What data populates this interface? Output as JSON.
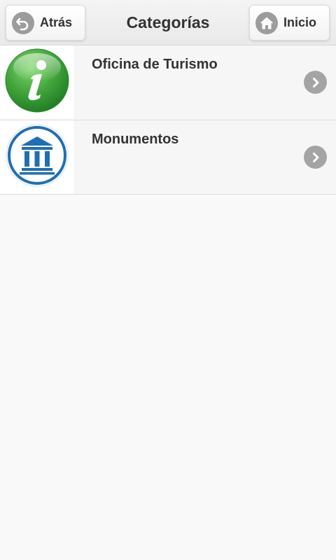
{
  "header": {
    "title": "Categorías",
    "back_label": "Atrás",
    "home_label": "Inicio"
  },
  "categories": [
    {
      "label": "Oficina de Turismo",
      "icon": "info-icon"
    },
    {
      "label": "Monumentos",
      "icon": "monument-icon"
    }
  ],
  "colors": {
    "info_green": "#3ba338",
    "monument_blue": "#1f6fb5",
    "chevron_gray": "#a4a4a4"
  }
}
